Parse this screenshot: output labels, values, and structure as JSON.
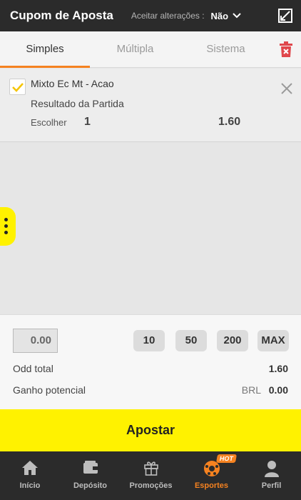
{
  "header": {
    "title": "Cupom de Aposta",
    "accept_label": "Aceitar alterações :",
    "accept_value": "Não",
    "expand_icon": "expand-icon"
  },
  "tabs": [
    {
      "label": "Simples",
      "active": true
    },
    {
      "label": "Múltipla",
      "active": false
    },
    {
      "label": "Sistema",
      "active": false
    }
  ],
  "bet": {
    "checked": true,
    "match": "Mixto Ec Mt - Acao",
    "market": "Resultado da Partida",
    "choose_label": "Escolher",
    "choose_value": "1",
    "odd": "1.60"
  },
  "stake": {
    "amount": "0.00",
    "quick": [
      "10",
      "50",
      "200",
      "MAX"
    ],
    "odd_total_label": "Odd total",
    "odd_total_value": "1.60",
    "gain_label": "Ganho potencial",
    "gain_currency": "BRL",
    "gain_value": "0.00"
  },
  "submit_label": "Apostar",
  "nav": {
    "items": [
      {
        "label": "Início",
        "icon": "home-icon",
        "active": false
      },
      {
        "label": "Depósito",
        "icon": "wallet-icon",
        "active": false
      },
      {
        "label": "Promoções",
        "icon": "gift-icon",
        "active": false
      },
      {
        "label": "Esportes",
        "icon": "soccer-ball-icon",
        "active": true,
        "badge": "HOT"
      },
      {
        "label": "Perfil",
        "icon": "user-icon",
        "active": false
      }
    ]
  },
  "colors": {
    "accent": "#f58220",
    "brand_yellow": "#fff200",
    "header_bg": "#2b2b2b",
    "trash": "#e0474c"
  }
}
